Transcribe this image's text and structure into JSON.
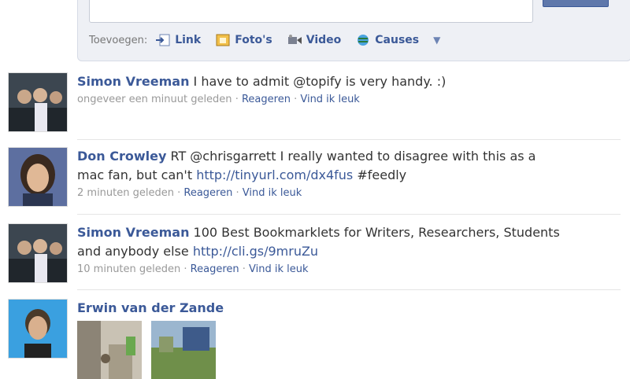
{
  "composer": {
    "attach_label": "Toevoegen:",
    "items": [
      {
        "label": "Link",
        "icon": "link-icon"
      },
      {
        "label": "Foto's",
        "icon": "photo-icon"
      },
      {
        "label": "Video",
        "icon": "video-icon"
      },
      {
        "label": "Causes",
        "icon": "causes-icon"
      }
    ],
    "more_icon": "▼"
  },
  "stories": [
    {
      "author": "Simon Vreeman",
      "text_before": " I have to admit @topify is very handy. :)",
      "link": "",
      "text_after": "",
      "time": "ongeveer een minuut geleden",
      "actions": [
        "Reageren",
        "Vind ik leuk"
      ]
    },
    {
      "author": "Don Crowley",
      "text_before": " RT @chrisgarrett I really wanted to disagree with this as a mac fan, but can't ",
      "link": "http://tinyurl.com/dx4fus",
      "text_after": " #feedly",
      "time": "2 minuten geleden",
      "actions": [
        "Reageren",
        "Vind ik leuk"
      ]
    },
    {
      "author": "Simon Vreeman",
      "text_before": " 100 Best Bookmarklets for Writers, Researchers, Students and anybody else ",
      "link": "http://cli.gs/9mruZu",
      "text_after": "",
      "time": "10 minuten geleden",
      "actions": [
        "Reageren",
        "Vind ik leuk"
      ]
    },
    {
      "author": "Erwin van der Zande"
    }
  ],
  "separator": " · ",
  "colors": {
    "link": "#3b5998",
    "muted": "#999999",
    "composer_bg": "#eef0f5"
  }
}
